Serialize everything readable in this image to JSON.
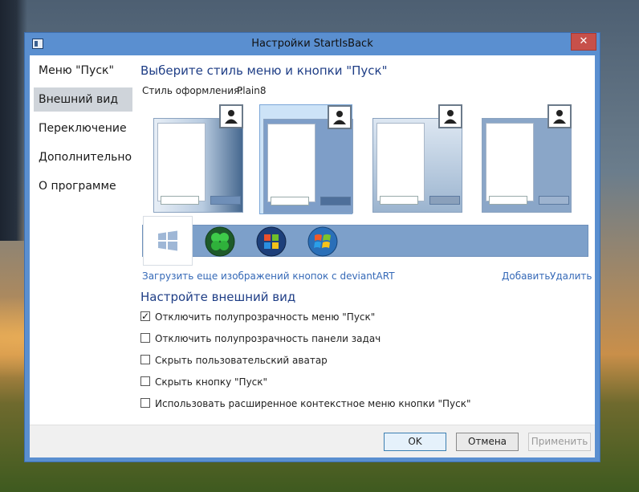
{
  "window": {
    "title": "Настройки StartIsBack",
    "close_glyph": "✕"
  },
  "sidebar": {
    "items": [
      {
        "label": "Меню \"Пуск\"",
        "active": false
      },
      {
        "label": "Внешний вид",
        "active": true
      },
      {
        "label": "Переключение",
        "active": false
      },
      {
        "label": "Дополнительно",
        "active": false
      },
      {
        "label": "О программе",
        "active": false
      }
    ]
  },
  "main": {
    "heading": "Выберите стиль меню и кнопки \"Пуск\"",
    "style_label": "Стиль оформления:",
    "style_value": "Plain8",
    "style_thumbnails": 4,
    "selected_thumbnail": 2,
    "start_buttons": [
      "windows8-logo-icon",
      "clover-orb-icon",
      "windows-orb-icon",
      "windows7-orb-icon"
    ],
    "download_link": "Загрузить еще изображений кнопок с deviantART",
    "add_link": "Добавить",
    "remove_link": "Удалить",
    "appearance_heading": "Настройте внешний вид",
    "options": [
      {
        "label": "Отключить полупрозрачность меню \"Пуск\"",
        "checked": true
      },
      {
        "label": "Отключить полупрозрачность панели задач",
        "checked": false
      },
      {
        "label": "Скрыть пользовательский аватар",
        "checked": false
      },
      {
        "label": "Скрыть кнопку \"Пуск\"",
        "checked": false
      },
      {
        "label": "Использовать расширенное контекстное меню кнопки \"Пуск\"",
        "checked": false
      }
    ]
  },
  "footer": {
    "ok": "OK",
    "cancel": "Отмена",
    "apply": "Применить"
  },
  "colors": {
    "window_frame": "#5a8fd0",
    "heading": "#1f3e86",
    "link": "#3569b7",
    "close": "#c7504a",
    "strip": "#7da0ca"
  }
}
